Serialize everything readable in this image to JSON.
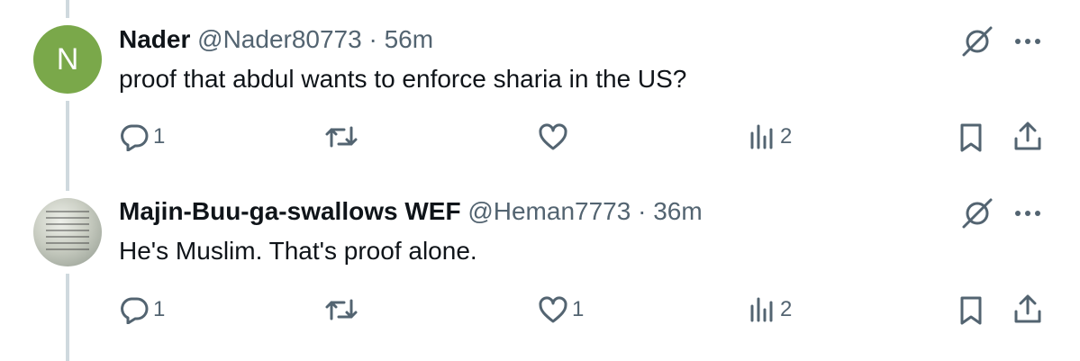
{
  "tweets": [
    {
      "avatar_letter": "N",
      "name": "Nader",
      "handle": "@Nader80773",
      "separator": "·",
      "time": "56m",
      "text": "proof that abdul wants to enforce sharia in the US?",
      "replies": "1",
      "retweets": "",
      "likes": "",
      "views": "2"
    },
    {
      "avatar_letter": "",
      "name": "Majin-Buu-ga-swallows WEF",
      "handle": "@Heman7773",
      "separator": "·",
      "time": "36m",
      "text": "He's Muslim. That's proof alone.",
      "replies": "1",
      "retweets": "",
      "likes": "1",
      "views": "2"
    }
  ],
  "colors": {
    "text": "#0f1419",
    "secondary": "#536471",
    "thread_line": "#cfd9de",
    "avatar_green": "#7aa84a"
  },
  "icons": [
    "grok-slash-icon",
    "more-icon",
    "reply-icon",
    "retweet-icon",
    "like-icon",
    "views-icon",
    "bookmark-icon",
    "share-icon"
  ]
}
